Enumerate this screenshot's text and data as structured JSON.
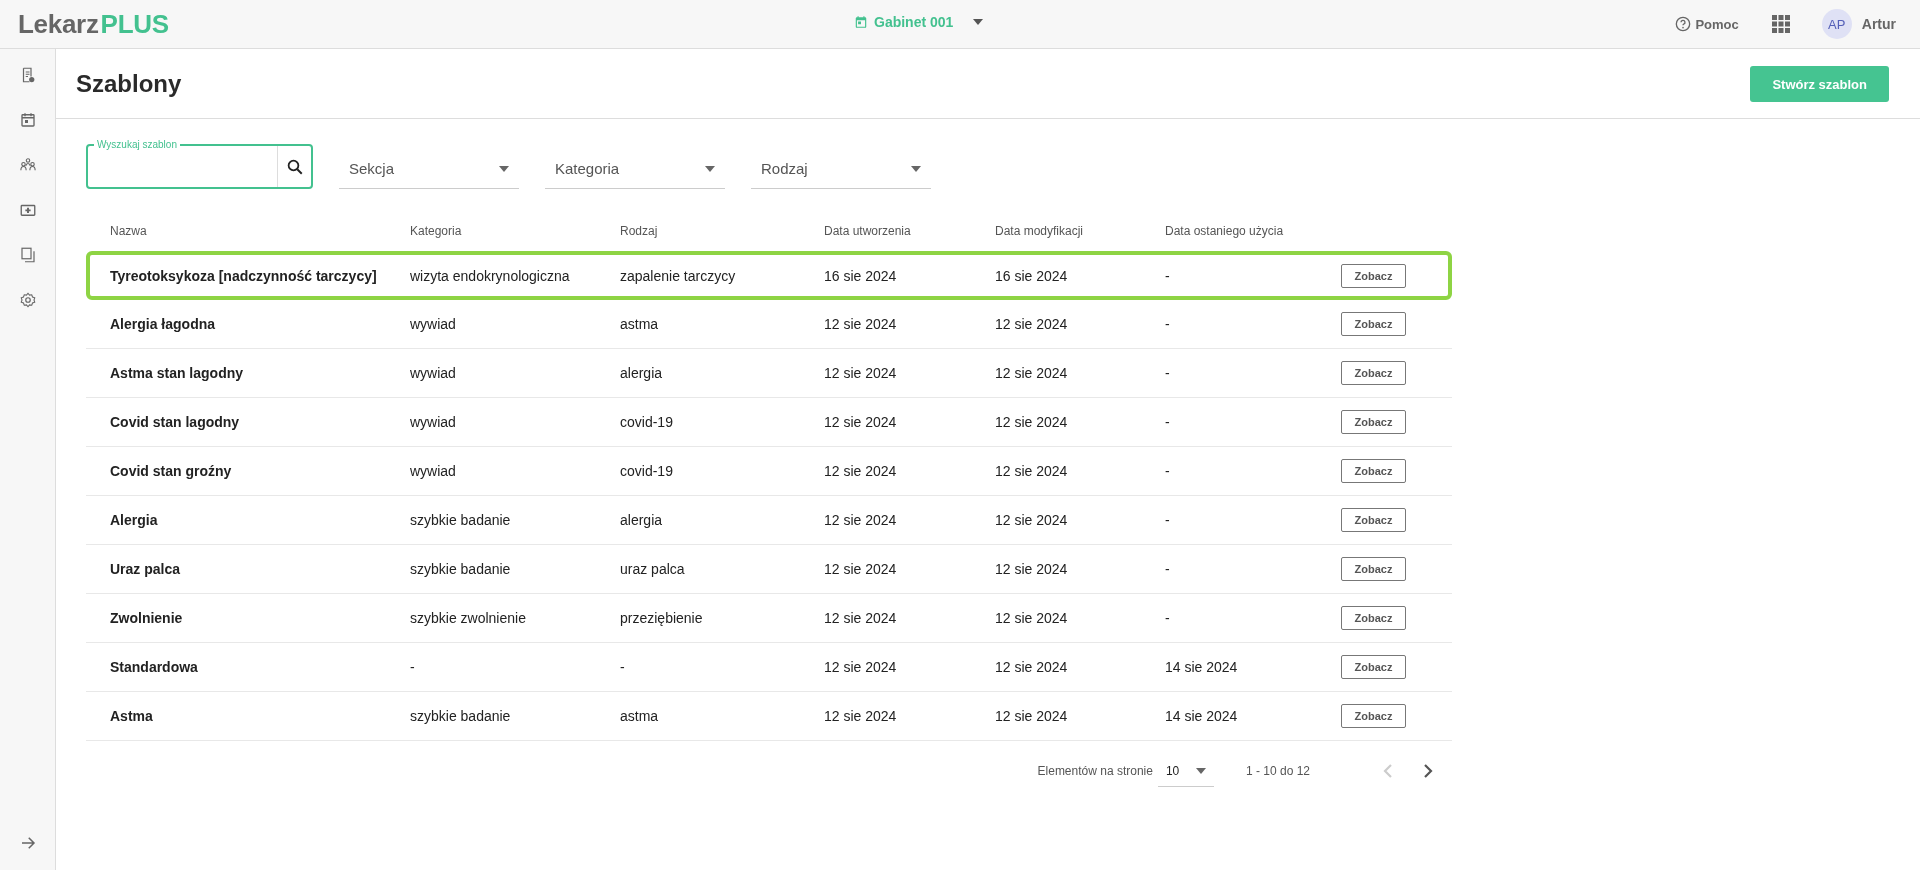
{
  "header": {
    "logo": {
      "part_1": "Lekarz",
      "part_2": "PLUS"
    },
    "office": "Gabinet 001",
    "help": "Pomoc",
    "user": {
      "initials": "AP",
      "name": "Artur"
    }
  },
  "page": {
    "title": "Szablony",
    "create_button": "Stwórz szablon"
  },
  "filters": {
    "search": {
      "label": "Wyszukaj szablon"
    },
    "selects": [
      "Sekcja",
      "Kategoria",
      "Rodzaj"
    ]
  },
  "table": {
    "columns": [
      "Nazwa",
      "Kategoria",
      "Rodzaj",
      "Data utworzenia",
      "Data modyfikacji",
      "Data ostaniego użycia"
    ],
    "rows": [
      {
        "cells": [
          "Tyreotoksykoza [nadczynność tarczycy]",
          "wizyta endokrynologiczna",
          "zapalenie tarczycy",
          "16 sie 2024",
          "16 sie 2024",
          "-"
        ],
        "action": "Zobacz",
        "selected": true
      },
      {
        "cells": [
          "Alergia łagodna",
          "wywiad",
          "astma",
          "12 sie 2024",
          "12 sie 2024",
          "-"
        ],
        "action": "Zobacz",
        "selected": false
      },
      {
        "cells": [
          "Astma stan lagodny",
          "wywiad",
          "alergia",
          "12 sie 2024",
          "12 sie 2024",
          "-"
        ],
        "action": "Zobacz",
        "selected": false
      },
      {
        "cells": [
          "Covid stan lagodny",
          "wywiad",
          "covid-19",
          "12 sie 2024",
          "12 sie 2024",
          "-"
        ],
        "action": "Zobacz",
        "selected": false
      },
      {
        "cells": [
          "Covid stan groźny",
          "wywiad",
          "covid-19",
          "12 sie 2024",
          "12 sie 2024",
          "-"
        ],
        "action": "Zobacz",
        "selected": false
      },
      {
        "cells": [
          "Alergia",
          "szybkie badanie",
          "alergia",
          "12 sie 2024",
          "12 sie 2024",
          "-"
        ],
        "action": "Zobacz",
        "selected": false
      },
      {
        "cells": [
          "Uraz palca",
          "szybkie badanie",
          "uraz palca",
          "12 sie 2024",
          "12 sie 2024",
          "-"
        ],
        "action": "Zobacz",
        "selected": false
      },
      {
        "cells": [
          "Zwolnienie",
          "szybkie zwolnienie",
          "przeziębienie",
          "12 sie 2024",
          "12 sie 2024",
          "-"
        ],
        "action": "Zobacz",
        "selected": false
      },
      {
        "cells": [
          "Standardowa",
          "-",
          "-",
          "12 sie 2024",
          "12 sie 2024",
          "14 sie 2024"
        ],
        "action": "Zobacz",
        "selected": false
      },
      {
        "cells": [
          "Astma",
          "szybkie badanie",
          "astma",
          "12 sie 2024",
          "12 sie 2024",
          "14 sie 2024"
        ],
        "action": "Zobacz",
        "selected": false
      }
    ]
  },
  "pagination": {
    "per_page_label": "Elementów na stronie",
    "per_page": "10",
    "range": "1 - 10 do 12",
    "prev_disabled": true,
    "next_disabled": false
  }
}
